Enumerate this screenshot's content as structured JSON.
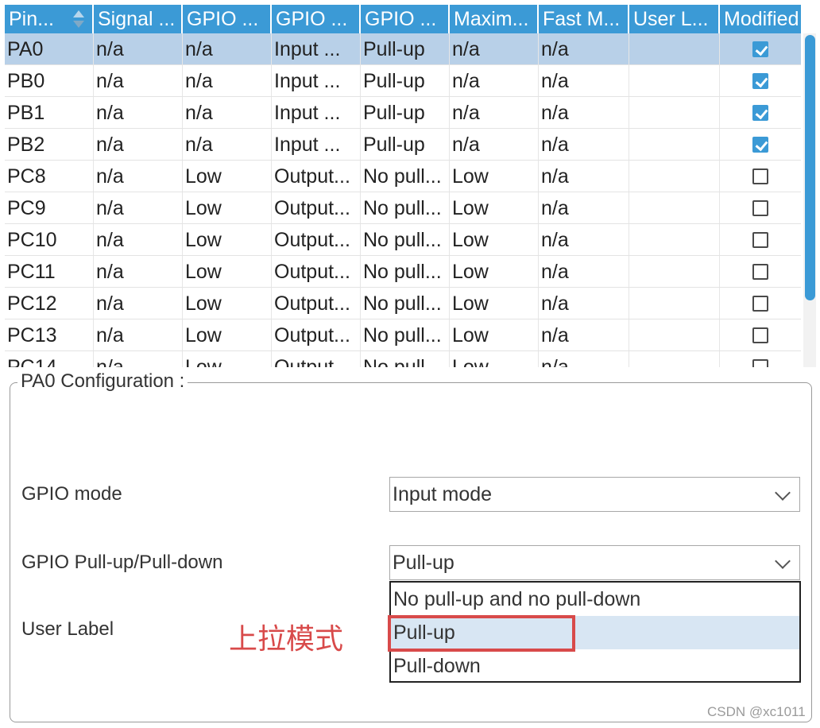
{
  "table": {
    "columns": [
      "Pin...",
      "Signal ...",
      "GPIO ...",
      "GPIO ...",
      "GPIO ...",
      "Maxim...",
      "Fast M...",
      "User L...",
      "Modified"
    ],
    "rows": [
      {
        "pin": "PA0",
        "signal": "n/a",
        "out_level": "n/a",
        "mode": "Input ...",
        "pull": "Pull-up",
        "max_speed": "n/a",
        "fast_mode": "n/a",
        "user_label": "",
        "modified": true,
        "selected": true
      },
      {
        "pin": "PB0",
        "signal": "n/a",
        "out_level": "n/a",
        "mode": "Input ...",
        "pull": "Pull-up",
        "max_speed": "n/a",
        "fast_mode": "n/a",
        "user_label": "",
        "modified": true
      },
      {
        "pin": "PB1",
        "signal": "n/a",
        "out_level": "n/a",
        "mode": "Input ...",
        "pull": "Pull-up",
        "max_speed": "n/a",
        "fast_mode": "n/a",
        "user_label": "",
        "modified": true
      },
      {
        "pin": "PB2",
        "signal": "n/a",
        "out_level": "n/a",
        "mode": "Input ...",
        "pull": "Pull-up",
        "max_speed": "n/a",
        "fast_mode": "n/a",
        "user_label": "",
        "modified": true
      },
      {
        "pin": "PC8",
        "signal": "n/a",
        "out_level": "Low",
        "mode": "Output...",
        "pull": "No pull...",
        "max_speed": "Low",
        "fast_mode": "n/a",
        "user_label": "",
        "modified": false
      },
      {
        "pin": "PC9",
        "signal": "n/a",
        "out_level": "Low",
        "mode": "Output...",
        "pull": "No pull...",
        "max_speed": "Low",
        "fast_mode": "n/a",
        "user_label": "",
        "modified": false
      },
      {
        "pin": "PC10",
        "signal": "n/a",
        "out_level": "Low",
        "mode": "Output...",
        "pull": "No pull...",
        "max_speed": "Low",
        "fast_mode": "n/a",
        "user_label": "",
        "modified": false
      },
      {
        "pin": "PC11",
        "signal": "n/a",
        "out_level": "Low",
        "mode": "Output...",
        "pull": "No pull...",
        "max_speed": "Low",
        "fast_mode": "n/a",
        "user_label": "",
        "modified": false
      },
      {
        "pin": "PC12",
        "signal": "n/a",
        "out_level": "Low",
        "mode": "Output...",
        "pull": "No pull...",
        "max_speed": "Low",
        "fast_mode": "n/a",
        "user_label": "",
        "modified": false
      },
      {
        "pin": "PC13",
        "signal": "n/a",
        "out_level": "Low",
        "mode": "Output...",
        "pull": "No pull...",
        "max_speed": "Low",
        "fast_mode": "n/a",
        "user_label": "",
        "modified": false
      },
      {
        "pin": "PC14",
        "signal": "n/a",
        "out_level": "Low",
        "mode": "Output...",
        "pull": "No pull...",
        "max_speed": "Low",
        "fast_mode": "n/a",
        "user_label": "",
        "modified": false
      }
    ]
  },
  "config": {
    "title": "PA0 Configuration :",
    "gpio_mode_label": "GPIO mode",
    "gpio_mode_value": "Input mode",
    "pull_label": "GPIO Pull-up/Pull-down",
    "pull_value": "Pull-up",
    "user_label_label": "User Label",
    "pull_options": [
      "No pull-up and no pull-down",
      "Pull-up",
      "Pull-down"
    ],
    "highlighted_option": "Pull-up"
  },
  "annotation": {
    "text": "上拉模式",
    "color": "#d84a4a"
  },
  "watermark": "CSDN @xc1011",
  "colors": {
    "header": "#3b9ad6",
    "selected_row": "#b8d0e8",
    "checkbox_checked": "#3b9ad6"
  }
}
